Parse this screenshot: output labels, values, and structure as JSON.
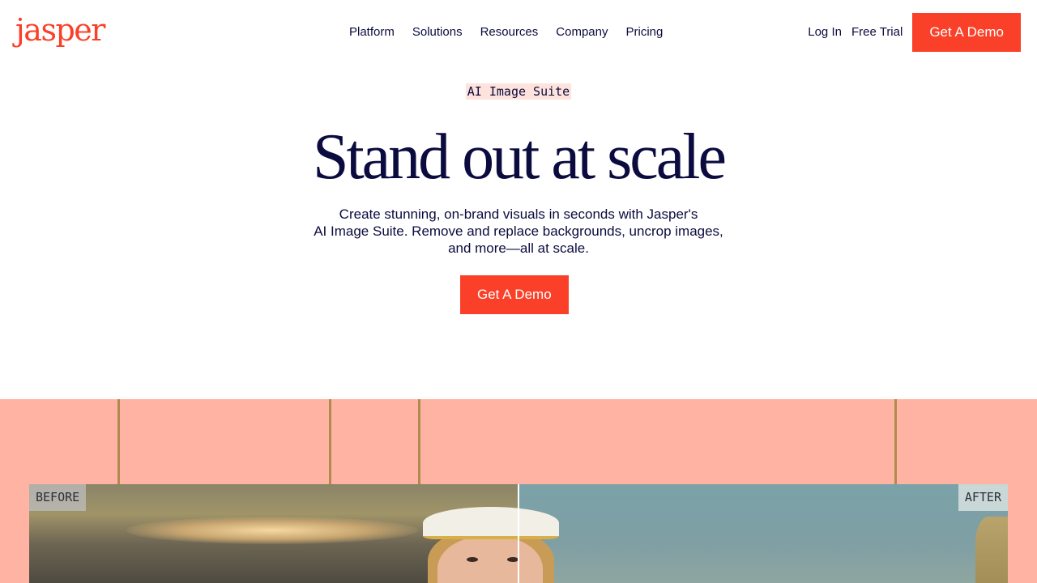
{
  "header": {
    "logo_text": "jasper",
    "nav": [
      {
        "label": "Platform"
      },
      {
        "label": "Solutions"
      },
      {
        "label": "Resources"
      },
      {
        "label": "Company"
      },
      {
        "label": "Pricing"
      }
    ],
    "login_label": "Log In",
    "free_trial_label": "Free Trial",
    "demo_label": "Get A Demo"
  },
  "hero": {
    "badge": "AI Image Suite",
    "title": "Stand out at scale",
    "subtitle_line1": "Create stunning, on-brand visuals in seconds with Jasper's",
    "subtitle_line2": "AI Image Suite. Remove and replace backgrounds, uncrop images,",
    "subtitle_line3": "and more—all at scale.",
    "cta_label": "Get A Demo"
  },
  "comparison": {
    "before_label": "BEFORE",
    "after_label": "AFTER"
  },
  "colors": {
    "brand": "#fa4028",
    "text": "#0b0b3f",
    "section_bg": "#ffb3a3",
    "badge_bg": "#fde3dc"
  }
}
